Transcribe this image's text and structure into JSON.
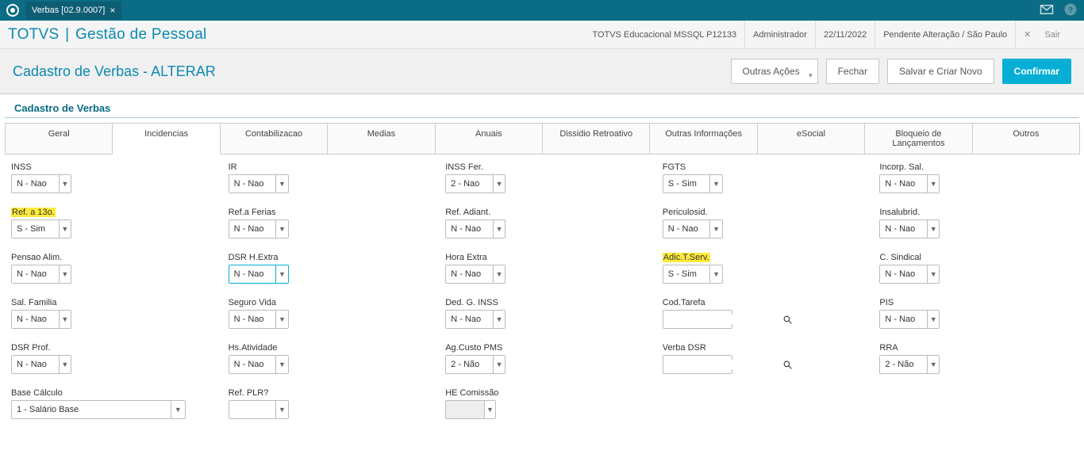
{
  "titlebar": {
    "tab_label": "Verbas [02.9.0007]"
  },
  "header": {
    "brand_left": "TOTVS",
    "brand_sep": "|",
    "brand_right": "Gestão de Pessoal",
    "env": "TOTVS Educacional MSSQL P12133",
    "user": "Administrador",
    "date": "22/11/2022",
    "status": "Pendente Alteração / São Paulo",
    "exit": "Sair"
  },
  "actionbar": {
    "title": "Cadastro de Verbas - ALTERAR",
    "outras_acoes": "Outras Ações",
    "fechar": "Fechar",
    "salvar_criar": "Salvar e Criar Novo",
    "confirmar": "Confirmar"
  },
  "section_title": "Cadastro de Verbas",
  "tabs": {
    "geral": "Geral",
    "incidencias": "Incidencias",
    "contab": "Contabilizacao",
    "medias": "Medias",
    "anuais": "Anuais",
    "dissidio": "Dissidio Retroativo",
    "outras_info": "Outras Informações",
    "esocial": "eSocial",
    "bloqueio": "Bloqueio de Lançamentos",
    "outros": "Outros"
  },
  "fields": {
    "inss": {
      "label": "INSS",
      "value": "N - Nao"
    },
    "ir": {
      "label": "IR",
      "value": "N - Nao"
    },
    "inss_fer": {
      "label": "INSS Fer.",
      "value": "2 - Nao"
    },
    "fgts": {
      "label": "FGTS",
      "value": "S - Sim"
    },
    "incorp": {
      "label": "Incorp. Sal.",
      "value": "N - Nao"
    },
    "ref13": {
      "label": "Ref. a 13o.",
      "value": "S - Sim",
      "hl": true
    },
    "ref_ferias": {
      "label": "Ref.a Ferias",
      "value": "N - Nao"
    },
    "ref_adiant": {
      "label": "Ref. Adiant.",
      "value": "N - Nao"
    },
    "periculosid": {
      "label": "Periculosid.",
      "value": "N - Nao"
    },
    "insalubrid": {
      "label": "Insalubrid.",
      "value": "N - Nao"
    },
    "pensao": {
      "label": "Pensao Alim.",
      "value": "N - Nao"
    },
    "dsr_hextra": {
      "label": "DSR H.Extra",
      "value": "N - Nao",
      "active": true
    },
    "hora_extra": {
      "label": "Hora Extra",
      "value": "N - Nao"
    },
    "adic_tserv": {
      "label": "Adic.T.Serv.",
      "value": "S - Sim",
      "hl": true
    },
    "csind": {
      "label": "C. Sindical",
      "value": "N - Nao"
    },
    "sal_fam": {
      "label": "Sal. Familia",
      "value": "N - Nao"
    },
    "seguro": {
      "label": "Seguro Vida",
      "value": "N - Nao"
    },
    "ded_inss": {
      "label": "Ded. G. INSS",
      "value": "N - Nao"
    },
    "cod_tarefa": {
      "label": "Cod.Tarefa",
      "value": ""
    },
    "pis": {
      "label": "PIS",
      "value": "N - Nao"
    },
    "dsr_prof": {
      "label": "DSR Prof.",
      "value": "N - Nao"
    },
    "hs_ativ": {
      "label": "Hs.Atividade",
      "value": "N - Nao"
    },
    "ag_custo": {
      "label": "Ag.Custo PMS",
      "value": "2 - Não"
    },
    "verba_dsr": {
      "label": "Verba DSR",
      "value": ""
    },
    "rra": {
      "label": "RRA",
      "value": "2 - Não"
    },
    "base_calc": {
      "label": "Base Cálculo",
      "value": "1 - Salário Base"
    },
    "ref_plr": {
      "label": "Ref. PLR?",
      "value": ""
    },
    "he_com": {
      "label": "HE Comissão",
      "value": ""
    }
  }
}
